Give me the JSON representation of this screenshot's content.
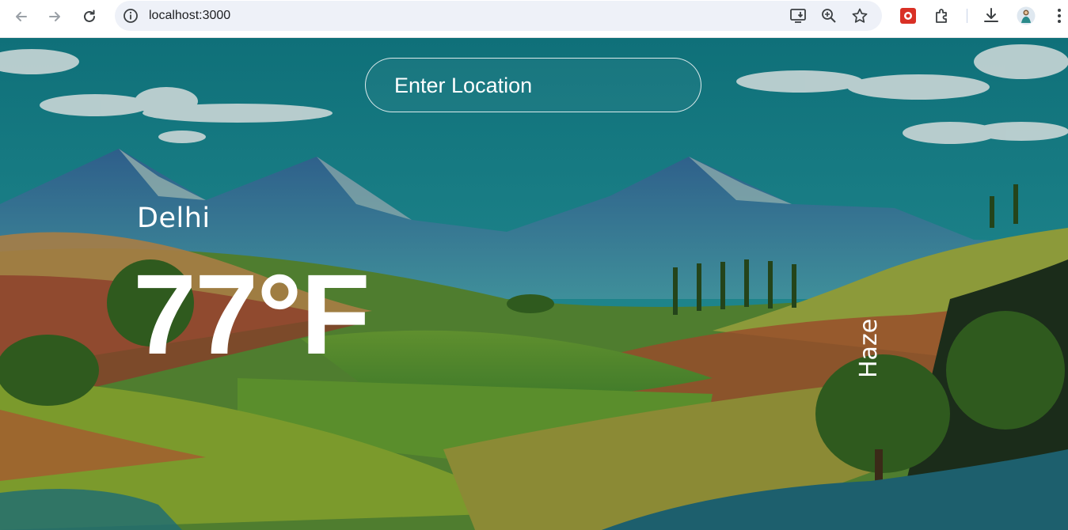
{
  "browser": {
    "url": "localhost:3000"
  },
  "app": {
    "search": {
      "placeholder": "Enter Location",
      "value": ""
    },
    "weather": {
      "city": "Delhi",
      "temperature": "77°F",
      "condition": "Haze"
    }
  },
  "icons": {
    "back": "arrow-left-icon",
    "forward": "arrow-right-icon",
    "reload": "reload-icon",
    "site_info": "info-icon",
    "install": "install-app-icon",
    "zoom": "zoom-icon",
    "bookmark": "star-icon",
    "extension_app": "extension-app-icon",
    "extensions": "puzzle-icon",
    "downloads": "download-icon",
    "profile": "avatar",
    "menu": "kebab-menu-icon"
  },
  "colors": {
    "sky": "#1b7d86",
    "chrome_bg": "#ffffff",
    "omnibox_bg": "#eef1f8",
    "text": "#ffffff"
  }
}
